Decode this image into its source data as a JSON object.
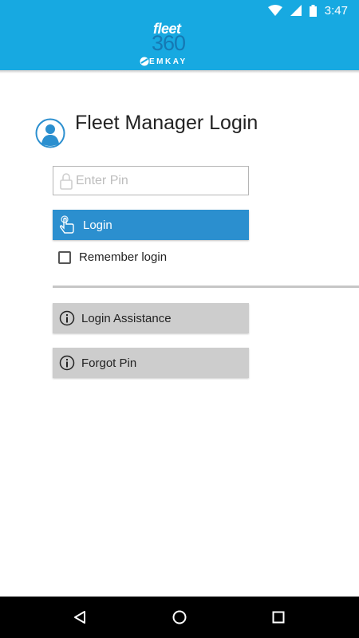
{
  "status_bar": {
    "time": "3:47"
  },
  "header": {
    "logo_fleet": "fleet",
    "logo_360": "360",
    "logo_emkay": "EMKAY",
    "color": "#17a9e1"
  },
  "login": {
    "title": "Fleet Manager Login",
    "pin_placeholder": "Enter Pin",
    "pin_value": "",
    "login_label": "Login",
    "remember_label": "Remember login",
    "remember_checked": false,
    "accent": "#2b8fcf"
  },
  "help": {
    "assistance_label": "Login Assistance",
    "forgot_label": "Forgot Pin"
  },
  "icons": {
    "wifi": "wifi-icon",
    "signal": "cell-signal-icon",
    "battery": "battery-icon",
    "avatar": "user-avatar-icon",
    "lock": "lock-icon",
    "touch": "touch-hand-icon",
    "info": "info-icon"
  }
}
